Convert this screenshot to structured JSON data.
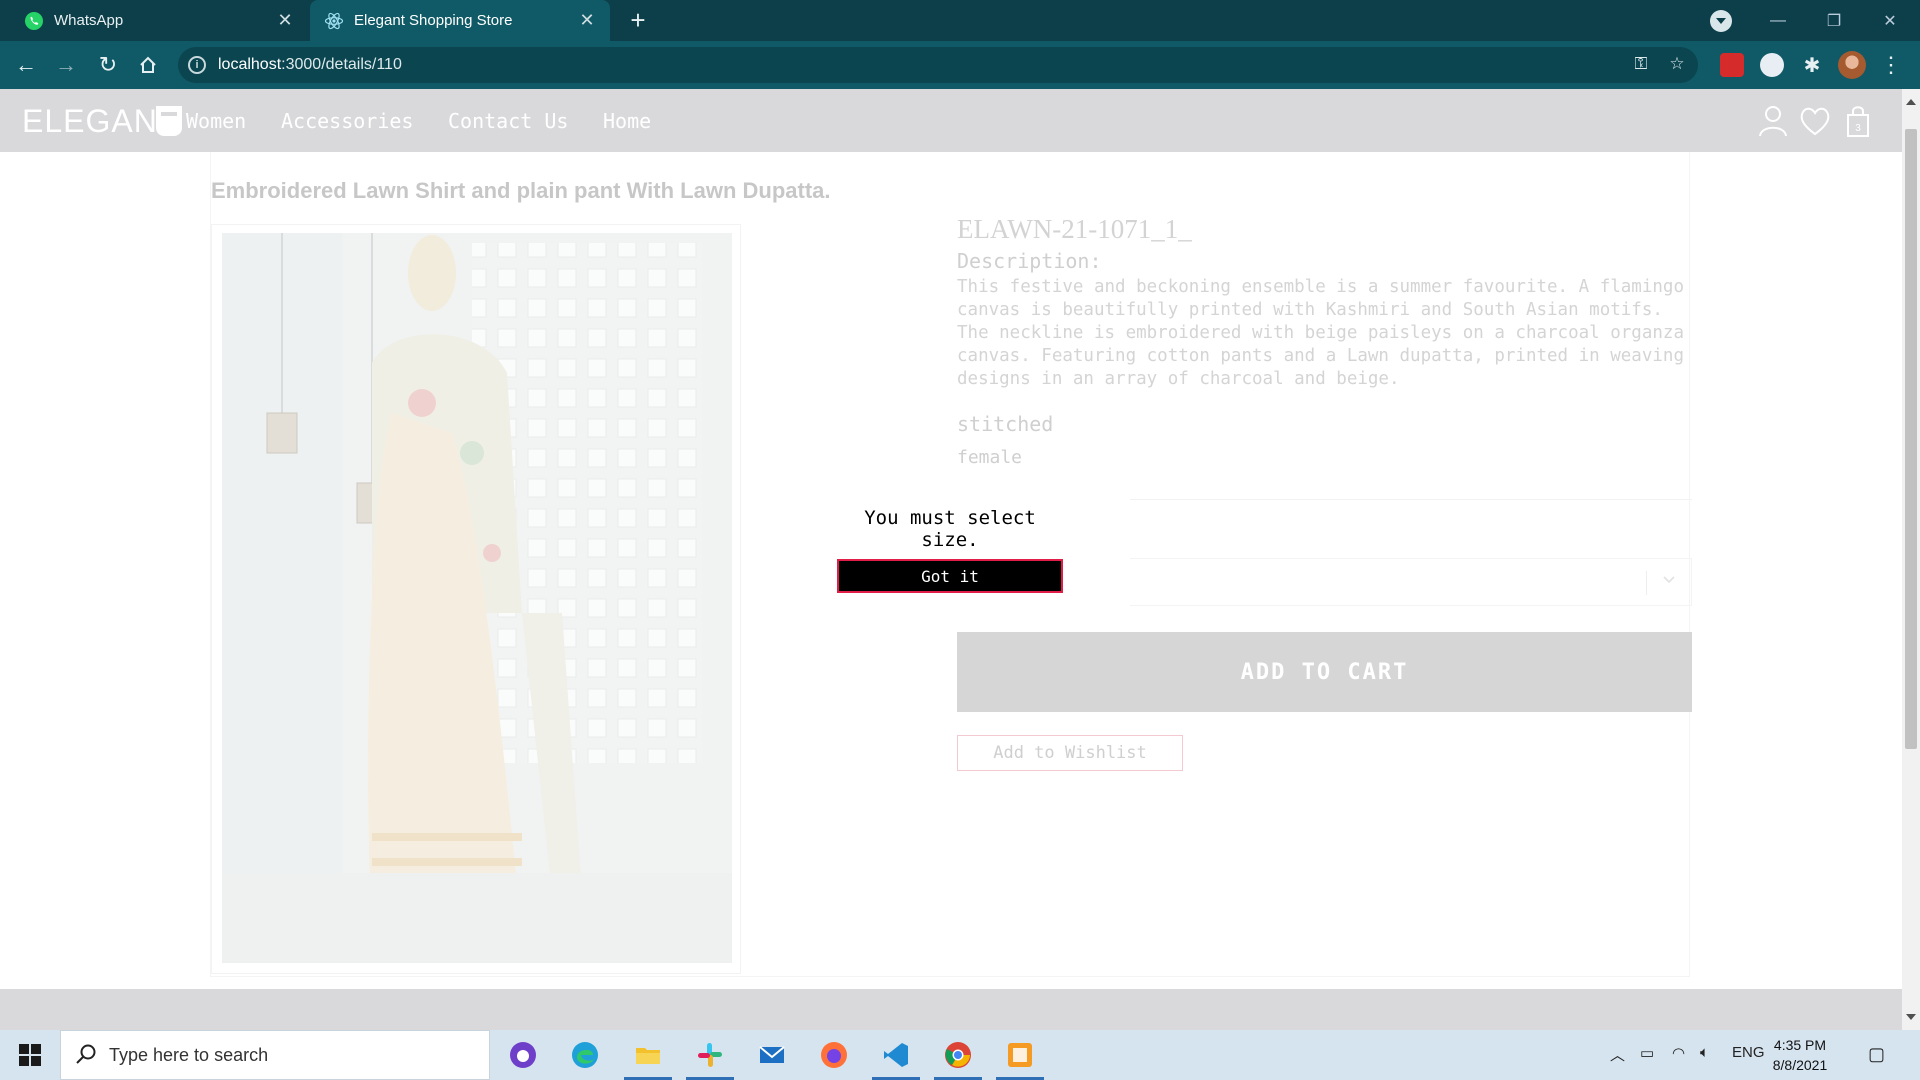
{
  "browser": {
    "tabs": [
      {
        "title": "WhatsApp",
        "icon": "whatsapp-icon"
      },
      {
        "title": "Elegant Shopping Store",
        "icon": "react-icon",
        "active": true
      }
    ],
    "url": {
      "host": "localhost",
      "path": ":3000/details/110"
    }
  },
  "site": {
    "logo": "ELEGAN",
    "nav": [
      "Women",
      "Accessories",
      "Contact Us",
      "Home"
    ],
    "cart_count": "3"
  },
  "product": {
    "title": "Embroidered Lawn Shirt and plain pant With Lawn Dupatta.",
    "sku": "ELAWN-21-1071_1_",
    "description_heading": "Description:",
    "description": "This festive and beckoning ensemble is a summer favourite. A flamingo canvas is beautifully printed with Kashmiri and South Asian motifs. The neckline is embroidered with beige paisleys on a charcoal organza canvas. Featuring cotton pants and a Lawn dupatta, printed in weaving designs in an array of charcoal and beige.",
    "stitch": "stitched",
    "gender": "female",
    "add_to_cart": "ADD TO CART",
    "add_to_wishlist": "Add to Wishlist"
  },
  "alert": {
    "message": "You must select size.",
    "button": "Got it"
  },
  "taskbar": {
    "search_placeholder": "Type here to search",
    "language": "ENG",
    "time": "4:35 PM",
    "date": "8/8/2021"
  },
  "colors": {
    "tabstrip": "#0d3f4a",
    "toolbar": "#0f5a66",
    "site_nav": "#d9d9dc",
    "add_to_cart_bg": "#d6d6d6",
    "alert_button_border": "#e11d48"
  }
}
